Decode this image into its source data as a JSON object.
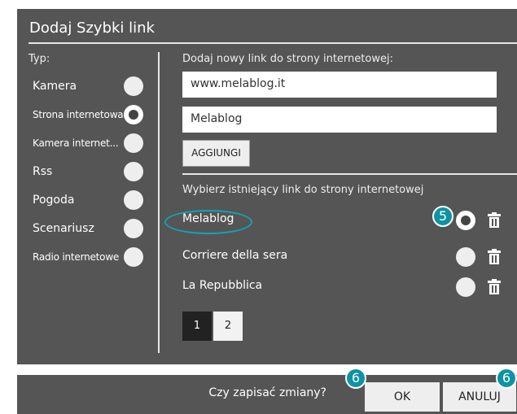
{
  "dialog": {
    "title": "Dodaj Szybki link",
    "type_label": "Typ:",
    "types": [
      {
        "label": "Kamera",
        "selected": false
      },
      {
        "label": "Strona internetowa",
        "selected": true
      },
      {
        "label": "Kamera internet...",
        "selected": false
      },
      {
        "label": "Rss",
        "selected": false
      },
      {
        "label": "Pogoda",
        "selected": false
      },
      {
        "label": "Scenariusz",
        "selected": false
      },
      {
        "label": "Radio internetowe",
        "selected": false
      }
    ],
    "new_link_label": "Dodaj nowy link do strony internetowej:",
    "url_value": "www.melablog.it",
    "name_value": "Melablog",
    "add_button": "AGGIUNGI",
    "existing_label": "Wybierz istniejący link do strony internetowej",
    "links": [
      {
        "label": "Melablog",
        "selected": true
      },
      {
        "label": "Corriere della sera",
        "selected": false
      },
      {
        "label": "La Repubblica",
        "selected": false
      }
    ],
    "pages": [
      "1",
      "2"
    ],
    "active_page": "1"
  },
  "footer": {
    "confirm_text": "Czy zapisać zmiany?",
    "ok_label": "OK",
    "cancel_label": "ANULUJ"
  },
  "callouts": {
    "step5": "5",
    "step6a": "6",
    "step6b": "6"
  },
  "colors": {
    "panel": "#555555",
    "accent": "#0e93a4",
    "radio": "#eeeeee"
  }
}
